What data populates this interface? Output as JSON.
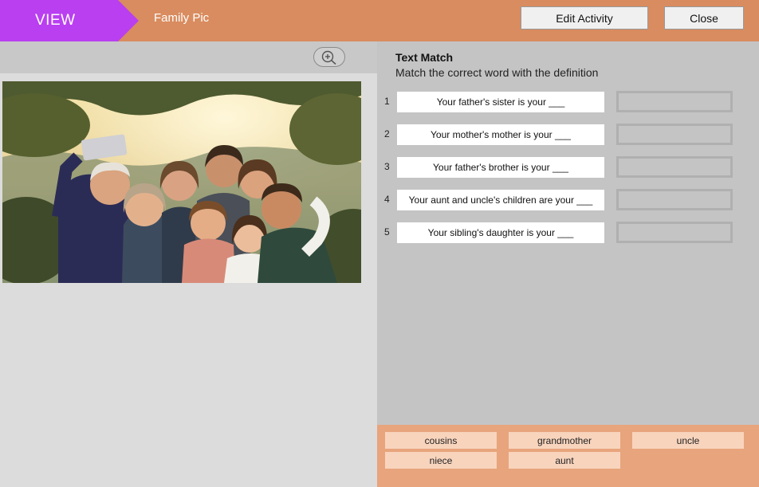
{
  "header": {
    "mode_label": "VIEW",
    "title": "Family Pic",
    "edit_button": "Edit Activity",
    "close_button": "Close",
    "badge_color": "#b93ff0",
    "bar_color": "#d98c5f"
  },
  "activity": {
    "title": "Text Match",
    "instructions": "Match the correct word with the definition",
    "questions": [
      {
        "number": "1",
        "text": "Your father's sister is your ___"
      },
      {
        "number": "2",
        "text": "Your mother's mother is your ___"
      },
      {
        "number": "3",
        "text": "Your father's brother is your ___"
      },
      {
        "number": "4",
        "text": "Your aunt and uncle's children are your ___"
      },
      {
        "number": "5",
        "text": "Your sibling's daughter is your ___"
      }
    ]
  },
  "word_bank": [
    "cousins",
    "grandmother",
    "uncle",
    "niece",
    "aunt"
  ],
  "image": {
    "icon": "zoom-in-icon",
    "subject": "family-selfie-photo"
  }
}
